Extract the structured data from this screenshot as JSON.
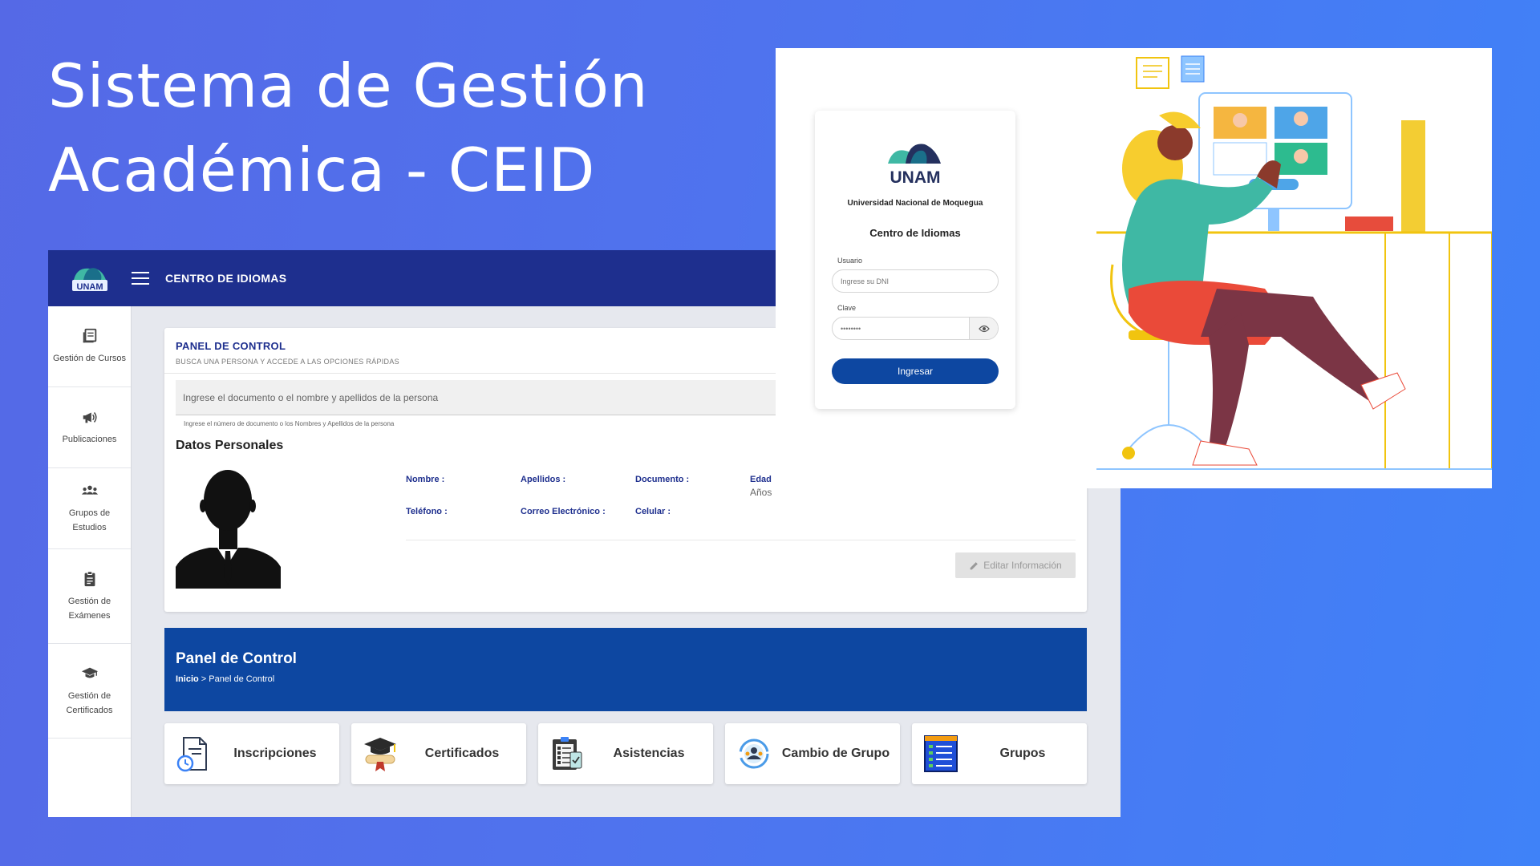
{
  "hero": {
    "line1": "Sistema de Gestión",
    "line2": "Académica - CEID"
  },
  "dashboard": {
    "logo_text": "UNAM",
    "app_title": "CENTRO DE IDIOMAS",
    "sidebar": {
      "items": [
        {
          "label": "Gestión de Cursos",
          "icon": "book-icon"
        },
        {
          "label": "Publicaciones",
          "icon": "megaphone-icon"
        },
        {
          "label": "Grupos de Estudios",
          "icon": "users-icon"
        },
        {
          "label": "Gestión de Exámenes",
          "icon": "clipboard-icon"
        },
        {
          "label": "Gestión de Certificados",
          "icon": "graduation-cap-icon"
        }
      ]
    },
    "panel": {
      "title": "PANEL DE CONTROL",
      "subtitle": "BUSCA UNA PERSONA Y ACCEDE A LAS OPCIONES RÁPIDAS",
      "search_placeholder": "Ingrese el documento o el nombre y apellidos de la persona",
      "search_hint": "Ingrese el número de documento o los Nombres y Apellidos de la persona",
      "section_title": "Datos Personales",
      "fields": {
        "nombre": "Nombre :",
        "apellidos": "Apellidos :",
        "documento": "Documento :",
        "edad": "Edad",
        "edad_unit": "Años",
        "telefono": "Teléfono :",
        "correo": "Correo Electrónico :",
        "celular": "Celular :"
      },
      "edit_button": "Editar Información"
    },
    "banner": {
      "title": "Panel de Control",
      "breadcrumb_home": "Inicio",
      "breadcrumb_sep": ">",
      "breadcrumb_current": "Panel de Control"
    },
    "quick_actions": [
      {
        "label": "Inscripciones",
        "icon": "document-clock-icon"
      },
      {
        "label": "Certificados",
        "icon": "diploma-icon"
      },
      {
        "label": "Asistencias",
        "icon": "attendance-icon"
      },
      {
        "label": "Cambio de Grupo",
        "icon": "group-change-icon"
      },
      {
        "label": "Grupos",
        "icon": "list-icon"
      }
    ]
  },
  "login": {
    "logo_text": "UNAM",
    "university": "Universidad Nacional de Moquegua",
    "centro": "Centro de Idiomas",
    "usuario_label": "Usuario",
    "usuario_placeholder": "Ingrese su DNI",
    "clave_label": "Clave",
    "clave_placeholder": "••••••••",
    "submit": "Ingresar"
  },
  "colors": {
    "primary": "#1e2f8e",
    "banner": "#0d47a1",
    "background_start": "#5569e6",
    "background_end": "#3f82f8"
  }
}
